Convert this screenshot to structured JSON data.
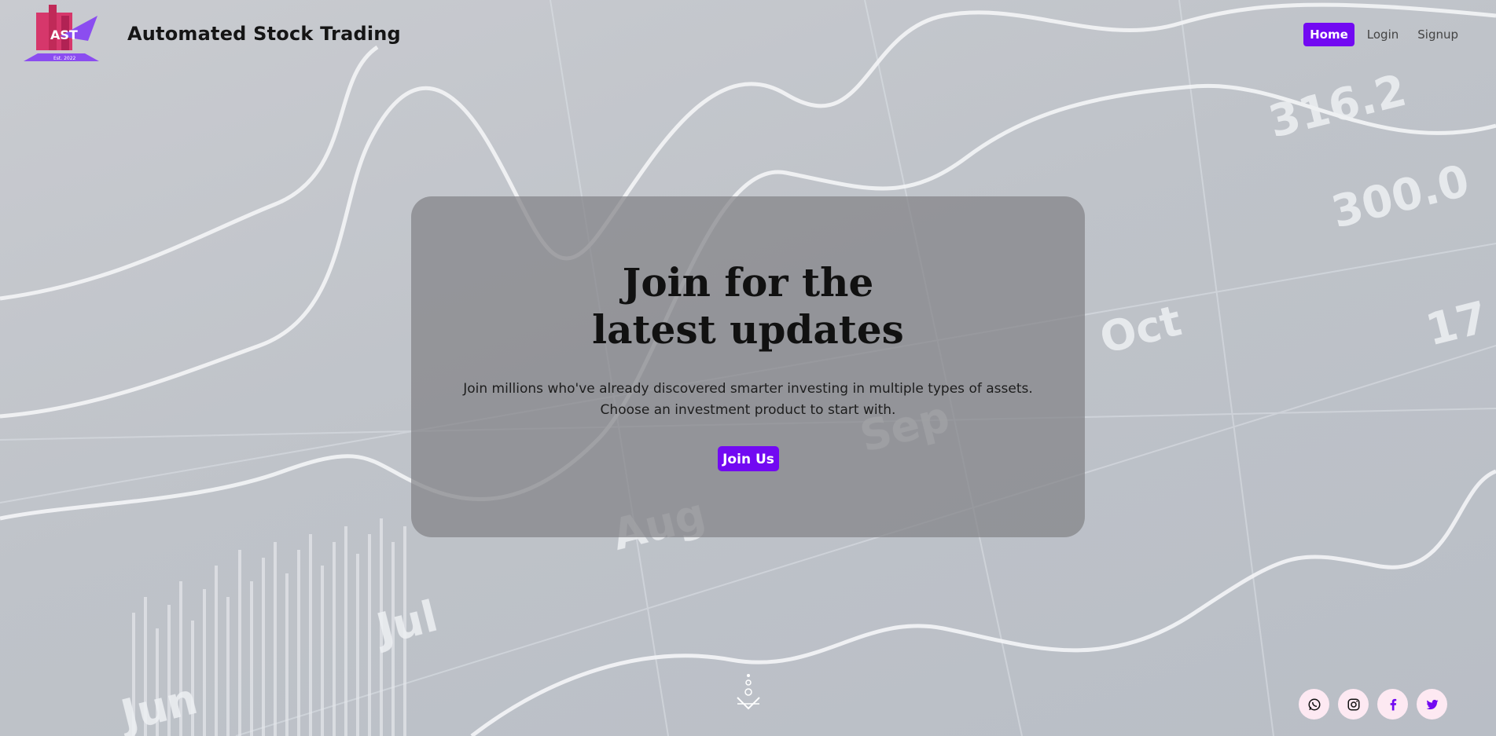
{
  "brand": {
    "name": "Automated Stock Trading",
    "logo_text": "AST",
    "logo_subtext": "Est. 2022"
  },
  "nav": {
    "items": [
      {
        "label": "Home",
        "active": true
      },
      {
        "label": "Login",
        "active": false
      },
      {
        "label": "Signup",
        "active": false
      }
    ]
  },
  "hero": {
    "title": "Join for the latest updates",
    "line1": "Join millions who've already discovered smarter investing in multiple types of assets.",
    "line2": "Choose an investment product to start with.",
    "button_label": "Join Us"
  },
  "background": {
    "month_labels": [
      "Jun",
      "Jul",
      "Aug",
      "Sep",
      "Oct"
    ],
    "numbers": [
      "316.2",
      "300.0",
      "17"
    ]
  },
  "socials": [
    {
      "name": "whatsapp-icon"
    },
    {
      "name": "instagram-icon"
    },
    {
      "name": "facebook-icon"
    },
    {
      "name": "twitter-icon"
    }
  ],
  "colors": {
    "accent": "#7209f2",
    "social_bg": "#fde9f2"
  }
}
